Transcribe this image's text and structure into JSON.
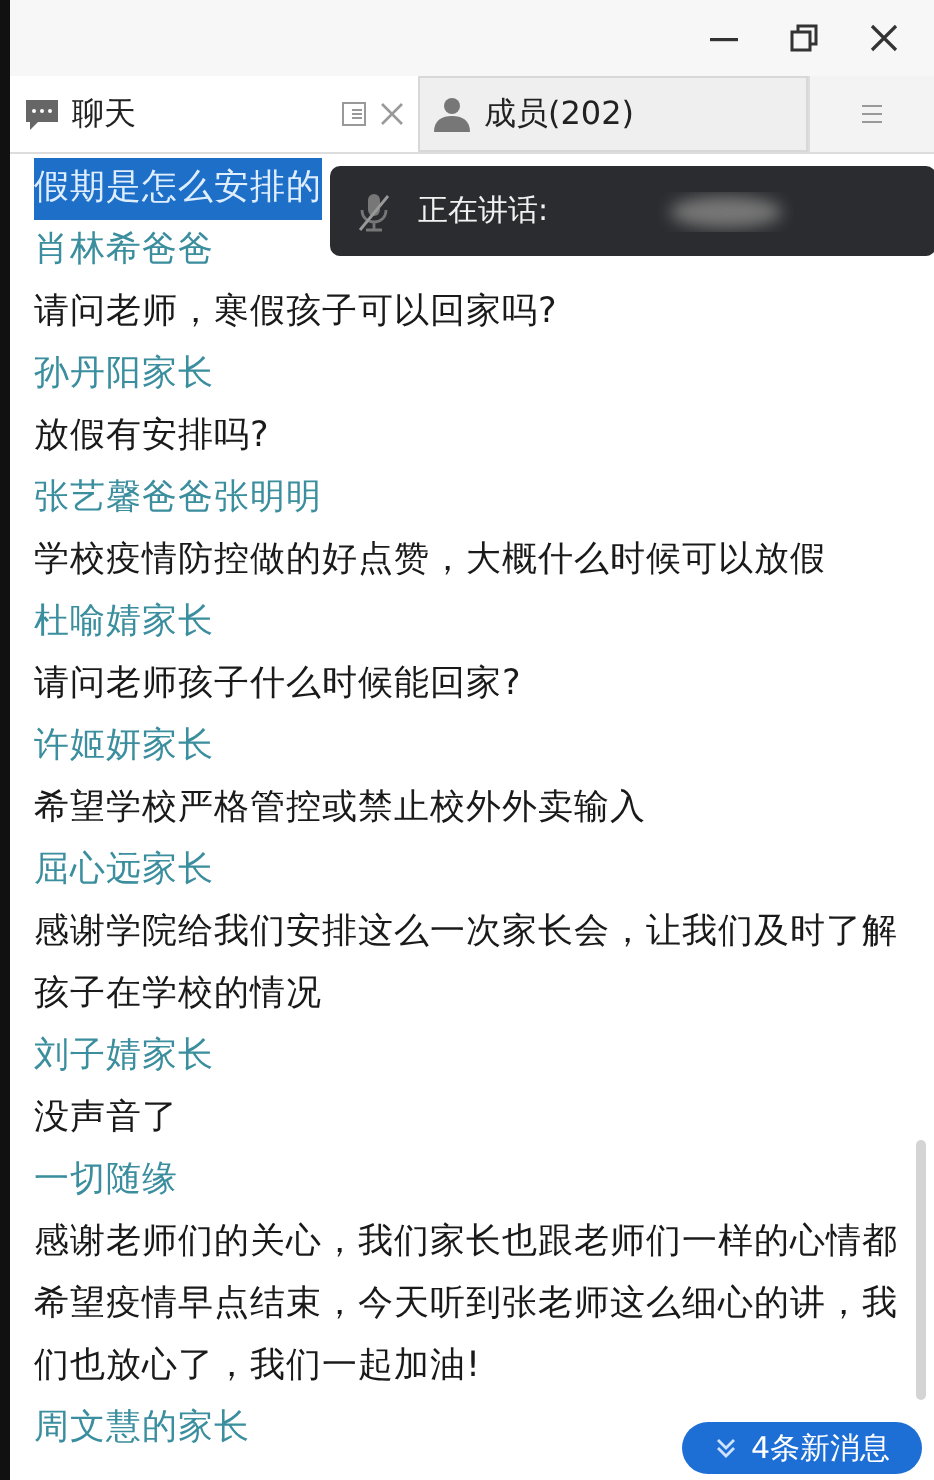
{
  "tabs": [
    {
      "label": "聊天",
      "selected": true
    },
    {
      "label": "成员(202)",
      "selected": false
    }
  ],
  "speaking_banner": {
    "label": "正在讲话:"
  },
  "messages": [
    {
      "text": "假期是怎么安排的",
      "selected": true
    },
    {
      "sender": "肖林希爸爸",
      "text": "请问老师，寒假孩子可以回家吗?"
    },
    {
      "sender": "孙丹阳家长",
      "text": "放假有安排吗?"
    },
    {
      "sender": "张艺馨爸爸张明明",
      "text": "学校疫情防控做的好点赞，大概什么时候可以放假"
    },
    {
      "sender": "杜喻婧家长",
      "text": "请问老师孩子什么时候能回家?"
    },
    {
      "sender": "许姬妍家长",
      "text": "希望学校严格管控或禁止校外外卖输入"
    },
    {
      "sender": "屈心远家长",
      "text": "感谢学院给我们安排这么一次家长会，让我们及时了解孩子在学校的情况"
    },
    {
      "sender": "刘子婧家长",
      "text": "没声音了"
    },
    {
      "sender": "一切随缘",
      "text": "感谢老师们的关心，我们家长也跟老师们一样的心情都希望疫情早点结束，今天听到张老师这么细心的讲，我们也放心了，我们一起加油!"
    },
    {
      "sender": "周文慧的家长"
    }
  ],
  "new_messages_button": {
    "label": "4条新消息"
  }
}
